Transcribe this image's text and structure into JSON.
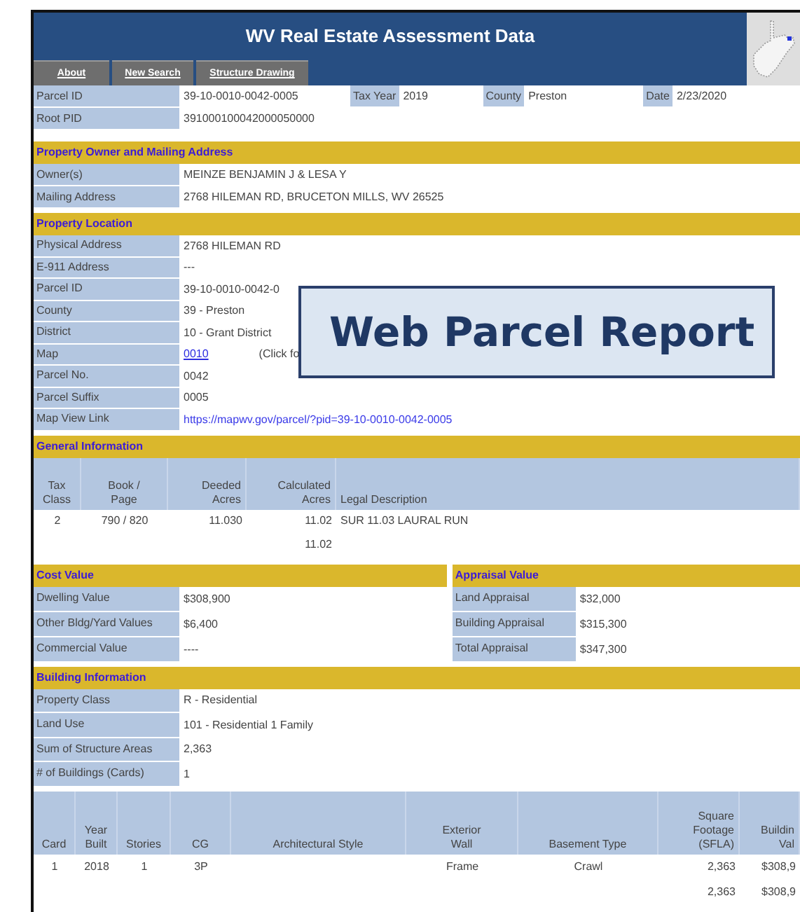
{
  "header": {
    "title": "WV Real Estate Assessment Data",
    "nav": [
      "About",
      "New Search",
      "Structure Drawing"
    ]
  },
  "summary_rows": [
    [
      {
        "label": "Parcel ID",
        "value": "39-10-0010-0042-0005"
      },
      {
        "label": "Tax Year",
        "value": "2019"
      },
      {
        "label": "County",
        "value": "Preston"
      },
      {
        "label": "Date",
        "value": "2/23/2020"
      }
    ],
    [
      {
        "label": "Root PID",
        "value": "391000100042000050000"
      }
    ]
  ],
  "sections": [
    {
      "kind": "fields",
      "title": "Property Owner and Mailing Address",
      "fields": [
        {
          "label": "Owner(s)",
          "value": "MEINZE BENJAMIN J & LESA Y"
        },
        {
          "label": "Mailing Address",
          "value": "2768 HILEMAN RD, BRUCETON MILLS, WV 26525"
        }
      ]
    },
    {
      "kind": "fields",
      "title": "Property Location",
      "fields": [
        {
          "label": "Physical Address",
          "value": "2768 HILEMAN RD"
        },
        {
          "label": "E-911 Address",
          "value": "---"
        },
        {
          "label": "Parcel ID",
          "value": "39-10-0010-0042-0"
        },
        {
          "label": "County",
          "value": "39 - Preston"
        },
        {
          "label": "District",
          "value": "10 - Grant District"
        },
        {
          "label": "Map",
          "value": "0010",
          "kind": "link",
          "note": "(Click fo"
        },
        {
          "label": "Parcel No.",
          "value": "0042"
        },
        {
          "label": "Parcel Suffix",
          "value": "0005"
        },
        {
          "label": "Map View Link",
          "value": "https://mapwv.gov/parcel/?pid=39-10-0010-0042-0005",
          "kind": "url"
        }
      ]
    },
    {
      "kind": "table",
      "title": "General Information",
      "columns": [
        {
          "label": "Tax\nClass",
          "kind": "center"
        },
        {
          "label": "Book /\nPage",
          "kind": "center"
        },
        {
          "label": "Deeded\nAcres",
          "kind": "right"
        },
        {
          "label": "Calculated\nAcres",
          "kind": "right"
        },
        {
          "label": "Legal Description",
          "kind": "left"
        }
      ],
      "rows": [
        [
          "2",
          "790 / 820",
          "11.030",
          "11.02",
          "SUR 11.03 LAURAL RUN"
        ],
        [
          null,
          null,
          null,
          "11.02",
          null
        ]
      ]
    },
    {
      "kind": "split",
      "panels": [
        {
          "title": "Cost Value",
          "fields": [
            {
              "label": "Dwelling Value",
              "value": "$308,900"
            },
            {
              "label": "Other Bldg/Yard Values",
              "value": "$6,400"
            },
            {
              "label": "Commercial Value",
              "value": "----"
            }
          ]
        },
        {
          "title": "Appraisal Value",
          "fields": [
            {
              "label": "Land Appraisal",
              "value": "$32,000"
            },
            {
              "label": "Building Appraisal",
              "value": "$315,300"
            },
            {
              "label": "Total Appraisal",
              "value": "$347,300"
            }
          ]
        }
      ]
    },
    {
      "kind": "fields",
      "title": "Building Information",
      "fields": [
        {
          "label": "Property Class",
          "value": "R - Residential"
        },
        {
          "label": "Land Use",
          "value": "101 - Residential 1 Family"
        },
        {
          "label": "Sum of Structure Areas",
          "value": "2,363"
        },
        {
          "label": "# of Buildings (Cards)",
          "value": "1"
        }
      ]
    },
    {
      "kind": "table",
      "columns": [
        {
          "label": "Card",
          "kind": "center"
        },
        {
          "label": "Year\nBuilt",
          "kind": "center"
        },
        {
          "label": "Stories",
          "kind": "center"
        },
        {
          "label": "CG",
          "kind": "center"
        },
        {
          "label": "Architectural Style",
          "kind": "center"
        },
        {
          "label": "Exterior\nWall",
          "kind": "center"
        },
        {
          "label": "Basement Type",
          "kind": "center"
        },
        {
          "label": "Square\nFootage\n(SFLA)",
          "kind": "right"
        },
        {
          "label": "Buildin\nVal",
          "kind": "right"
        }
      ],
      "rows": [
        [
          "1",
          "2018",
          "1",
          "3P",
          null,
          "Frame",
          "Crawl",
          "2,363",
          "$308,9"
        ],
        [
          null,
          null,
          null,
          null,
          null,
          null,
          null,
          "2,363",
          "$308,9"
        ]
      ]
    }
  ],
  "callout": {
    "text": "Web Parcel Report"
  }
}
